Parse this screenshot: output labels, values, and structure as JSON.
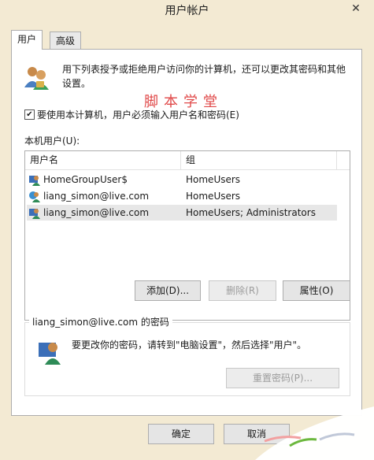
{
  "window": {
    "title": "用户帐户",
    "close_label": "✕"
  },
  "tabs": [
    {
      "label": "用户",
      "active": true
    },
    {
      "label": "高级",
      "active": false
    }
  ],
  "intro": {
    "text": "用下列表授予或拒绝用户访问你的计算机，还可以更改其密码和其他设置。"
  },
  "watermark": "脚本学堂",
  "require_login": {
    "label": "要使用本计算机，用户必须输入用户名和密码(E)",
    "checked": true,
    "check_glyph": "✔"
  },
  "local_users": {
    "label": "本机用户(U):",
    "columns": [
      "用户名",
      "组"
    ],
    "rows": [
      {
        "name": "HomeGroupUser$",
        "group": "HomeUsers",
        "selected": false,
        "icon": "user-icon"
      },
      {
        "name": "liang_simon@live.com",
        "group": "HomeUsers",
        "selected": false,
        "icon": "user-online-icon"
      },
      {
        "name": "liang_simon@live.com",
        "group": "HomeUsers; Administrators",
        "selected": true,
        "icon": "user-icon"
      }
    ]
  },
  "buttons": {
    "add": "添加(D)...",
    "remove": "删除(R)",
    "properties": "属性(O)",
    "ok": "确定",
    "cancel": "取消"
  },
  "password_group": {
    "title": "liang_simon@live.com 的密码",
    "text": "要更改你的密码，请转到\"电脑设置\"，然后选择\"用户\"。",
    "reset_button": "重置密码(P)..."
  }
}
